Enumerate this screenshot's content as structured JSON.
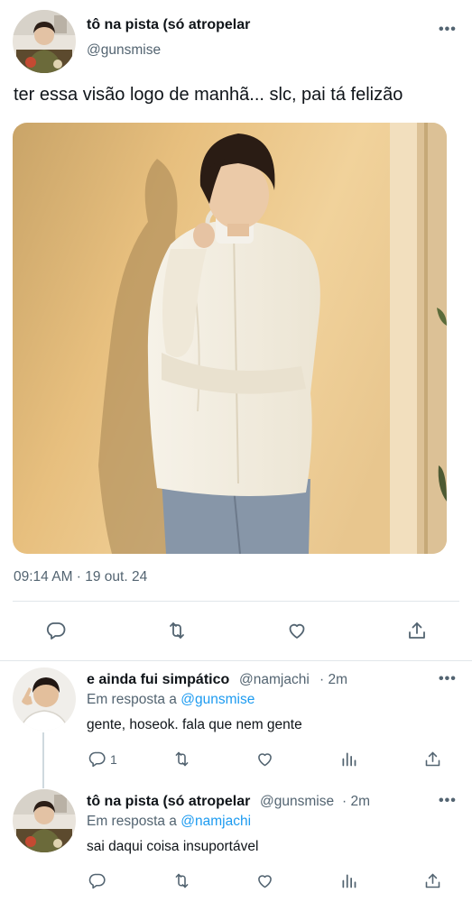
{
  "main_tweet": {
    "display_name": "tô na pista (só atropelar",
    "handle": "@gunsmise",
    "text": "ter essa visão logo de manhã... slc, pai tá felizão",
    "timestamp": "09:14 AM · 19 out. 24",
    "actions": [
      "reply-icon",
      "retweet-icon",
      "like-icon",
      "share-icon"
    ]
  },
  "replies": [
    {
      "display_name": "e ainda fui simpático",
      "handle": "@namjachi",
      "age": "· 2m",
      "reply_prefix": "Em resposta a",
      "reply_to": "@gunsmise",
      "text": "gente, hoseok. fala que nem gente",
      "reply_count": "1"
    },
    {
      "display_name": "tô na pista (só atropelar",
      "handle": "@gunsmise",
      "age": "· 2m",
      "reply_prefix": "Em resposta a",
      "reply_to": "@namjachi",
      "text": "sai daqui coisa insuportável",
      "reply_count": ""
    }
  ],
  "colors": {
    "link": "#1d9bf0",
    "secondary_text": "#536471",
    "primary_text": "#0f1419",
    "divider": "#e1e6ea"
  }
}
